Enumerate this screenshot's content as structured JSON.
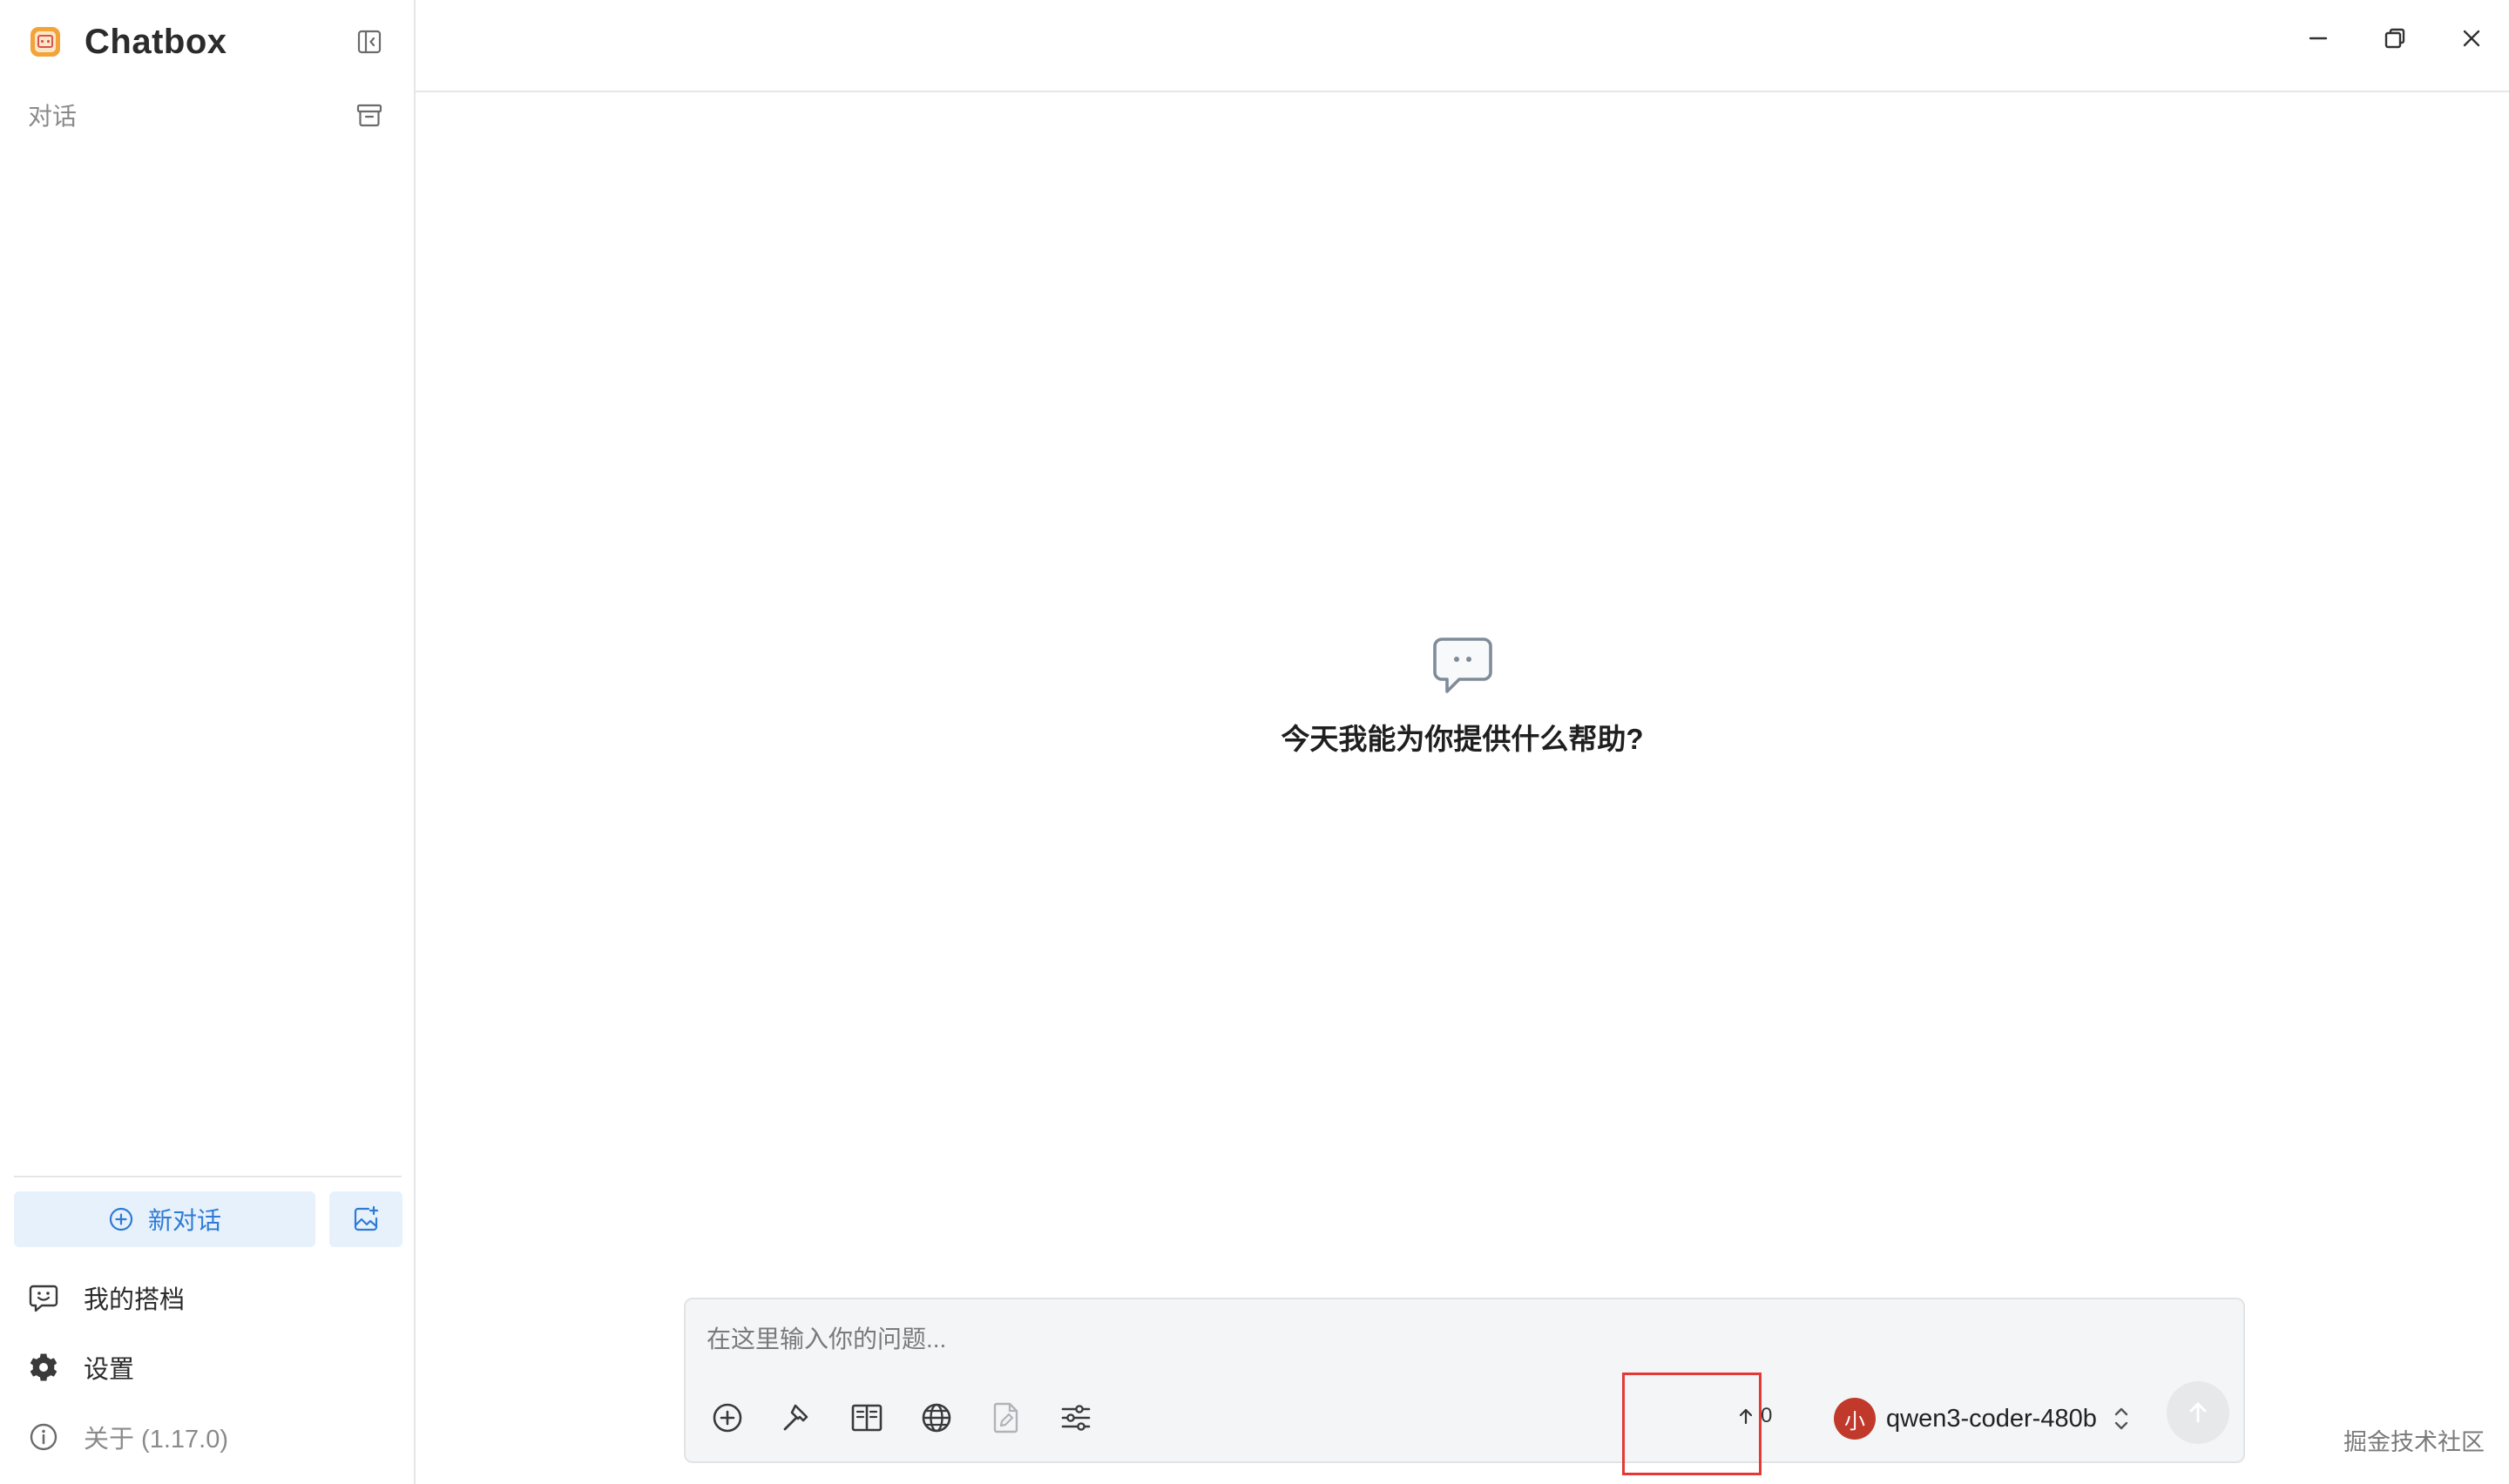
{
  "app": {
    "title": "Chatbox"
  },
  "sidebar": {
    "section_label": "对话",
    "new_chat_label": "新对话",
    "items": [
      {
        "label": "我的搭档"
      },
      {
        "label": "设置"
      },
      {
        "label": "关于 (1.17.0)"
      }
    ]
  },
  "main": {
    "empty_state_text": "今天我能为你提供什么帮助?"
  },
  "composer": {
    "placeholder": "在这里输入你的问题...",
    "token_count": "0",
    "model_avatar_text": "小",
    "model_name": "qwen3-coder-480b"
  },
  "watermark": "掘金技术社区",
  "colors": {
    "accent": "#2e7bd6",
    "accent_bg": "#e7f1fc",
    "avatar": "#c0392b",
    "highlight": "#e53935"
  }
}
